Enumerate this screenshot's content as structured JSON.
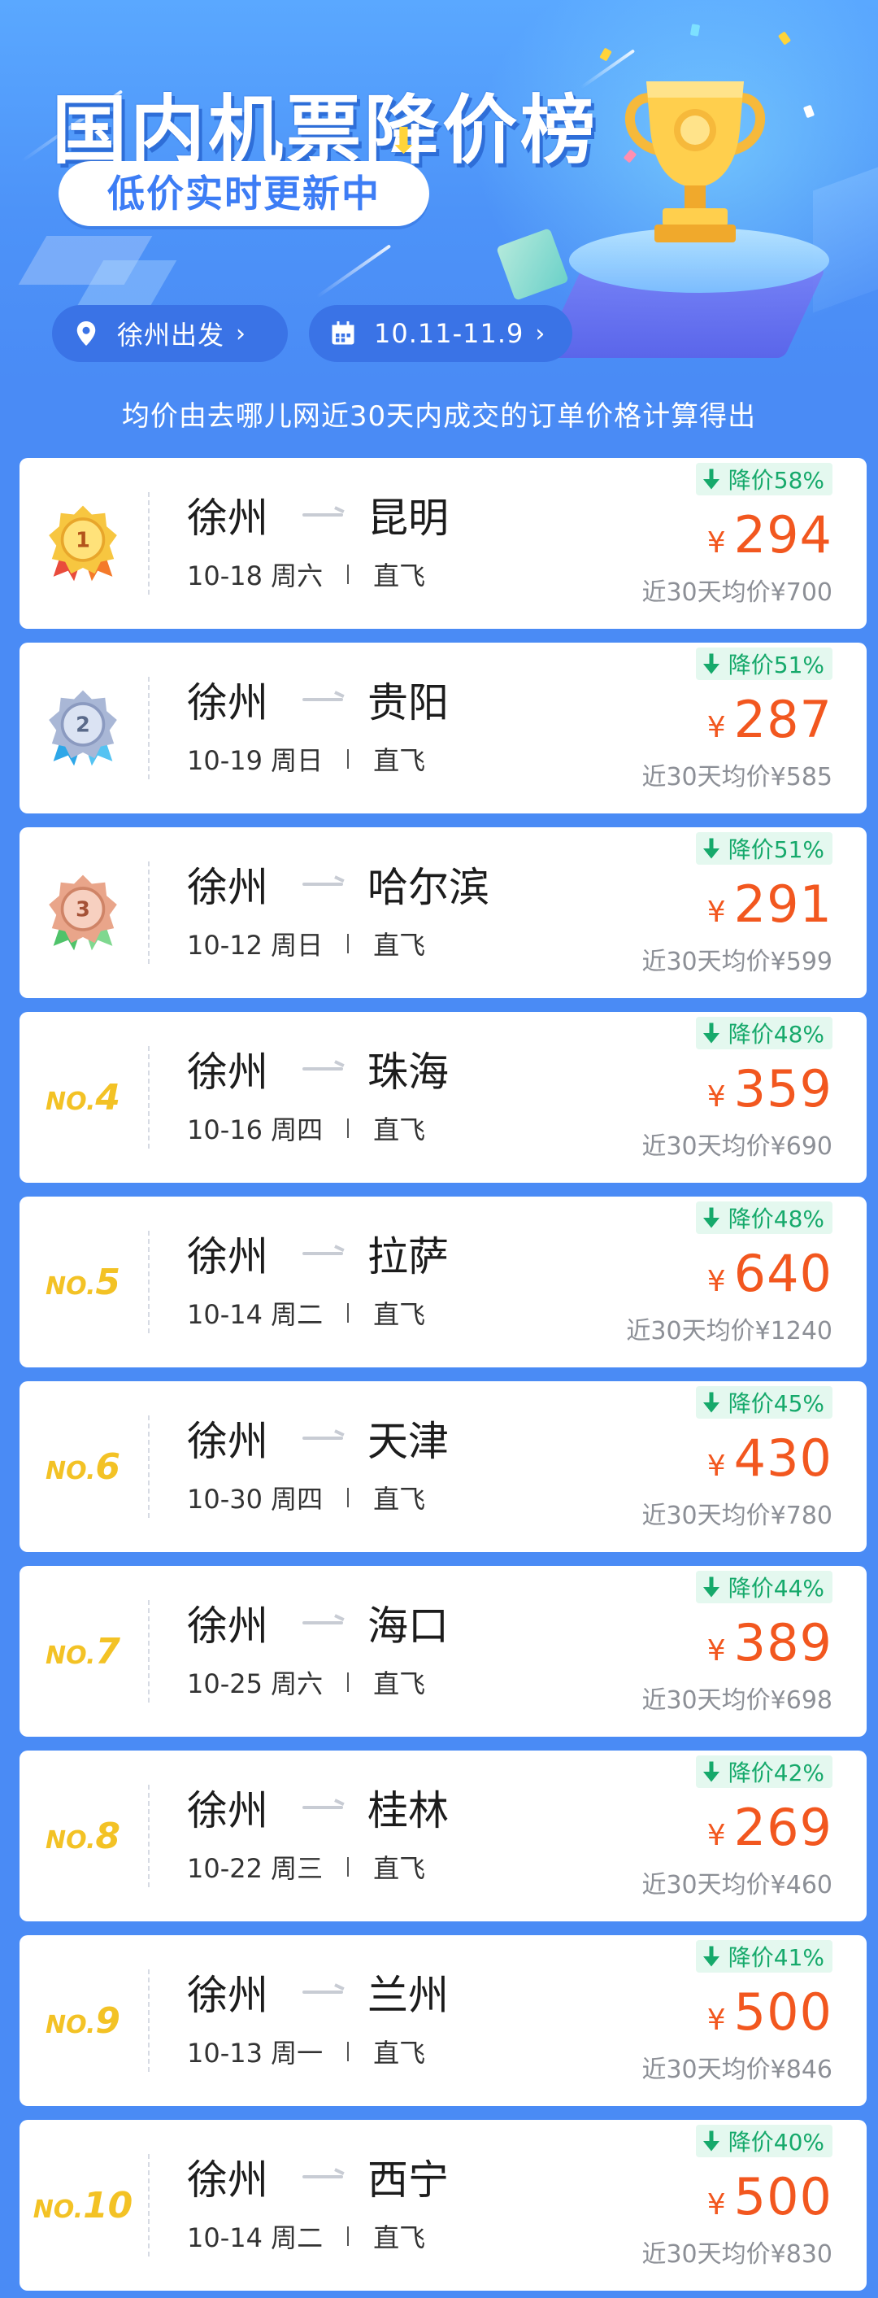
{
  "header": {
    "title": "国内机票降价榜",
    "subtitle": "低价实时更新中"
  },
  "filters": {
    "departure": "徐州出发",
    "date_range": "10.11-11.9"
  },
  "note": "均价由去哪儿网近30天内成交的订单价格计算得出",
  "colors": {
    "accent_blue": "#4a8bf5",
    "price_orange": "#f2571f",
    "drop_green": "#16a96b",
    "rank_gold": "#f3c225"
  },
  "flights": [
    {
      "rank_type": "medal-gold",
      "rank_prefix": "",
      "rank_num": "1",
      "from": "徐州",
      "to": "昆明",
      "date": "10-18 周六",
      "type": "直飞",
      "drop": "降价58%",
      "yen": "¥",
      "price": "294",
      "avg": "近30天均价¥700"
    },
    {
      "rank_type": "medal-silver",
      "rank_prefix": "",
      "rank_num": "2",
      "from": "徐州",
      "to": "贵阳",
      "date": "10-19 周日",
      "type": "直飞",
      "drop": "降价51%",
      "yen": "¥",
      "price": "287",
      "avg": "近30天均价¥585"
    },
    {
      "rank_type": "medal-bronze",
      "rank_prefix": "",
      "rank_num": "3",
      "from": "徐州",
      "to": "哈尔滨",
      "date": "10-12 周日",
      "type": "直飞",
      "drop": "降价51%",
      "yen": "¥",
      "price": "291",
      "avg": "近30天均价¥599"
    },
    {
      "rank_type": "no",
      "rank_prefix": "NO.",
      "rank_num": "4",
      "from": "徐州",
      "to": "珠海",
      "date": "10-16 周四",
      "type": "直飞",
      "drop": "降价48%",
      "yen": "¥",
      "price": "359",
      "avg": "近30天均价¥690"
    },
    {
      "rank_type": "no",
      "rank_prefix": "NO.",
      "rank_num": "5",
      "from": "徐州",
      "to": "拉萨",
      "date": "10-14 周二",
      "type": "直飞",
      "drop": "降价48%",
      "yen": "¥",
      "price": "640",
      "avg": "近30天均价¥1240"
    },
    {
      "rank_type": "no",
      "rank_prefix": "NO.",
      "rank_num": "6",
      "from": "徐州",
      "to": "天津",
      "date": "10-30 周四",
      "type": "直飞",
      "drop": "降价45%",
      "yen": "¥",
      "price": "430",
      "avg": "近30天均价¥780"
    },
    {
      "rank_type": "no",
      "rank_prefix": "NO.",
      "rank_num": "7",
      "from": "徐州",
      "to": "海口",
      "date": "10-25 周六",
      "type": "直飞",
      "drop": "降价44%",
      "yen": "¥",
      "price": "389",
      "avg": "近30天均价¥698"
    },
    {
      "rank_type": "no",
      "rank_prefix": "NO.",
      "rank_num": "8",
      "from": "徐州",
      "to": "桂林",
      "date": "10-22 周三",
      "type": "直飞",
      "drop": "降价42%",
      "yen": "¥",
      "price": "269",
      "avg": "近30天均价¥460"
    },
    {
      "rank_type": "no",
      "rank_prefix": "NO.",
      "rank_num": "9",
      "from": "徐州",
      "to": "兰州",
      "date": "10-13 周一",
      "type": "直飞",
      "drop": "降价41%",
      "yen": "¥",
      "price": "500",
      "avg": "近30天均价¥846"
    },
    {
      "rank_type": "no",
      "rank_prefix": "NO.",
      "rank_num": "10",
      "from": "徐州",
      "to": "西宁",
      "date": "10-14 周二",
      "type": "直飞",
      "drop": "降价40%",
      "yen": "¥",
      "price": "500",
      "avg": "近30天均价¥830"
    }
  ]
}
